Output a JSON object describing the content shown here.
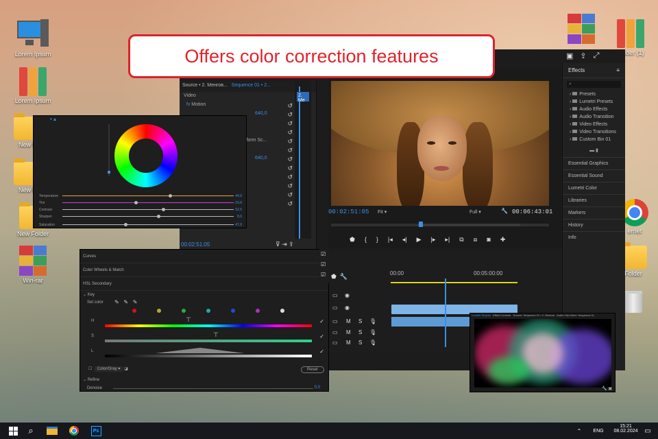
{
  "banner": {
    "text": "Offers color correction features"
  },
  "desktop": {
    "icons_left": [
      "Lorem Ipsum",
      "Lorem Ipsum",
      "New Folder",
      "New Folder",
      "New Folder",
      "Win-rar"
    ],
    "icons_left_truncated": [
      "New F",
      "New F"
    ],
    "icons_right": [
      "Folder (1)",
      "ernet",
      "Folder"
    ]
  },
  "source_panel": {
    "tab": "Source • 2. Менгов...",
    "sequence_tab": "Sequence 01 • 2...",
    "video_label": "Video",
    "fx_label": "Motion",
    "values": [
      "640,0",
      "640,0"
    ],
    "uniform_label": "iform Sc...",
    "timecode": "00:02:51:05",
    "clip_label": "2. Me"
  },
  "program": {
    "timecode_left": "00:02:51:05",
    "fit": "Fit",
    "full": "Full",
    "timecode_right": "00:06:43:01"
  },
  "effects_panel": {
    "title": "Effects",
    "items": [
      "Presets",
      "Lumetri Presets",
      "Audio Effects",
      "Audio Transition",
      "Video Effects",
      "Video Transitions",
      "Custom Bin 01"
    ],
    "sections": [
      "Essential Graphics",
      "Essential Sound",
      "Lumetri Color",
      "Libraries",
      "Markers",
      "History",
      "Info"
    ]
  },
  "timeline": {
    "ruler_start": "00:00",
    "ruler_mid": "00:05:00:00",
    "track_m": "M",
    "track_s": "S"
  },
  "lumetri": {
    "sliders": [
      {
        "name": "Temperature",
        "value": "44,8",
        "pos": 0.62,
        "color": "#e8a24a"
      },
      {
        "name": "Tint",
        "value": "-23,8",
        "pos": 0.42,
        "color": "#c93fd6"
      },
      {
        "name": "Contrast",
        "value": "52,5",
        "pos": 0.58,
        "color": "#bbbbbb"
      },
      {
        "name": "Sharpen",
        "value": "8,6",
        "pos": 0.55,
        "color": "#bbbbbb"
      },
      {
        "name": "Saturation",
        "value": "47,8",
        "pos": 0.36,
        "color": "#bbbbbb"
      }
    ]
  },
  "hsl": {
    "sections": [
      "Curves",
      "Color Wheels & Match",
      "HSL Secondary"
    ],
    "key_label": "Key",
    "set_color": "Set color",
    "h_label": "H",
    "s_label": "S",
    "l_label": "L",
    "color_gray": "Color/Gray",
    "reset": "Reset",
    "refine": "Refine",
    "denoise": "Denoise",
    "denoise_value": "0,0",
    "swatches": [
      "#c8161d",
      "#b6a92b",
      "#2faa3a",
      "#24a8a8",
      "#2946d8",
      "#b02fc2",
      "#dddddd"
    ]
  },
  "scope": {
    "tab1": "Lumetri Scopes",
    "tab2": "Effect Controls",
    "tab3": "Source: Sequence 01 • 2. Менгов",
    "tab4": "Audio Clip Mixer: Sequence 01"
  },
  "taskbar": {
    "lang": "ENG",
    "time": "15:21",
    "date": "08.02.2024",
    "ps": "Ps"
  }
}
